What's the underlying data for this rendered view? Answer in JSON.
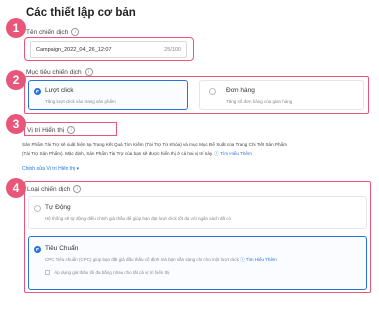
{
  "page_title": "Các thiết lập cơ bản",
  "badges": [
    "1",
    "2",
    "3",
    "4"
  ],
  "campaign_name": {
    "label": "Tên chiến dịch",
    "value": "Campaign_2022_04_26_12:07",
    "counter": "25/100"
  },
  "objective": {
    "label": "Mục tiêu chiến dịch",
    "options": [
      {
        "title": "Lượt click",
        "desc": "Tăng lượt click vào trang sản phẩm",
        "selected": true
      },
      {
        "title": "Đơn hàng",
        "desc": "Tăng số đơn hàng của gian hàng",
        "selected": false
      }
    ]
  },
  "placement": {
    "label": "Vị trí Hiển thị",
    "text_line1": "Sản Phẩm Tài Trợ sẽ xuất hiện tại Trang Kết Quả Tìm Kiếm (Tài Trợ Từ Khóa) và mục Mục Để Xuất của Trang Chi Tiết Sản Phẩm",
    "text_line2": "(Tài Trợ Sản Phẩm). Mặc định, Sản Phẩm Tài Trợ của bạn sẽ được hiển thị ở cả hai vị trí này.",
    "learn_more": "Tìm Hiểu Thêm",
    "edit_link": "Chỉnh sửa Vị trí Hiển thị"
  },
  "bidding": {
    "label": "Loại chiến dịch",
    "options": [
      {
        "title": "Tự Động",
        "desc": "Hệ thống sẽ tự động điều chỉnh giá thầu để giúp bạn đạt lượt click tốt đa với ngân sách đã có",
        "selected": false
      },
      {
        "title": "Tiêu Chuẩn",
        "desc": "CPC Tiêu chuẩn (CPC) giúp bạn đặt giá đấu thầu cố định mà bạn sẵn sàng chi cho một lượt click",
        "learn_more": "Tìm Hiểu Thêm",
        "selected": true
      }
    ],
    "checkbox_label": "Áp dụng giá thầu tối đa bằng nhau cho tất cả vị trí hiển thị"
  },
  "colors": {
    "highlight": "#e8577a",
    "accent": "#2673dd"
  }
}
